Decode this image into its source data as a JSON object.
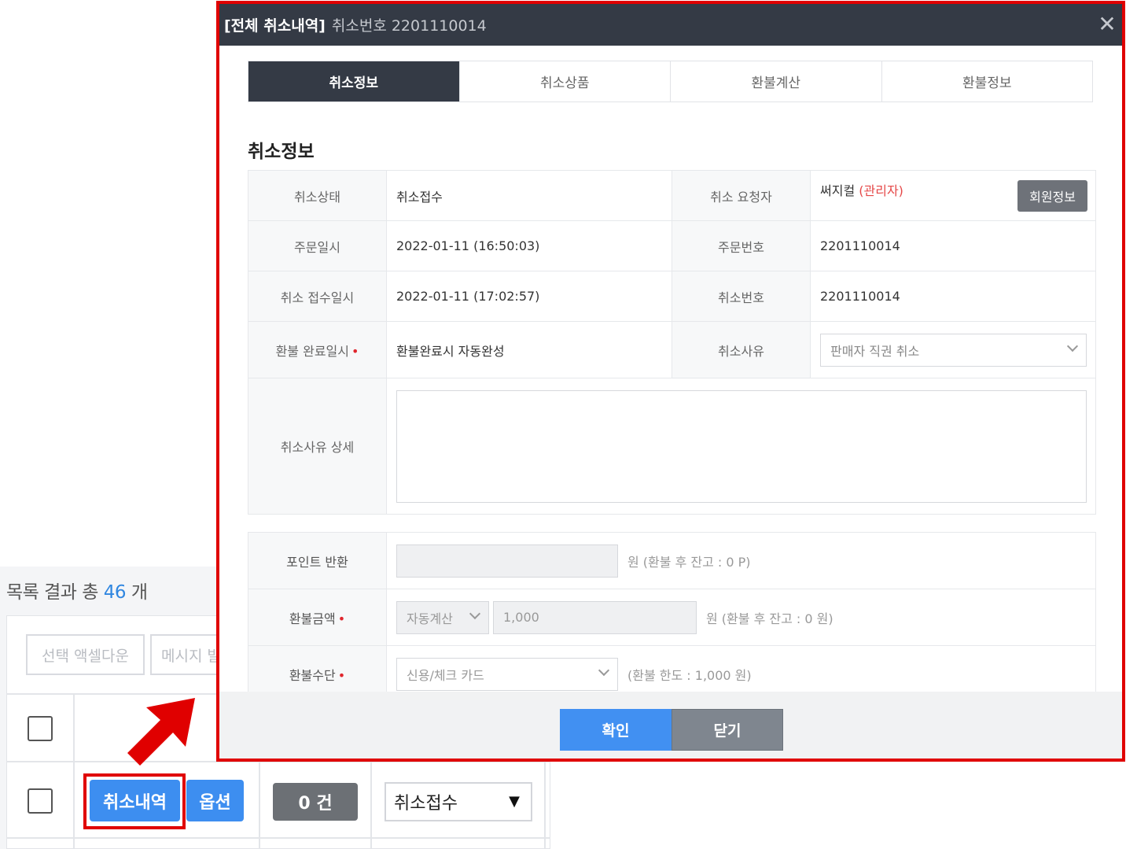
{
  "background": {
    "result_prefix": "목록 결과 총 ",
    "result_count": "46",
    "result_suffix": " 개",
    "toolbar": {
      "excel_button": "선택 액셀다운",
      "message_button": "메시지 발"
    },
    "row": {
      "cancel_history_button": "취소내역",
      "option_button": "옵션",
      "count_badge": "0 건",
      "status_select_value": "취소접수"
    }
  },
  "modal": {
    "title_main": "[전체 취소내역]",
    "title_sub": "취소번호 2201110014",
    "close_icon": "close-icon",
    "tabs": [
      {
        "label": "취소정보",
        "active": true
      },
      {
        "label": "취소상품",
        "active": false
      },
      {
        "label": "환불계산",
        "active": false
      },
      {
        "label": "환불정보",
        "active": false
      }
    ],
    "section_title": "취소정보",
    "info": {
      "cancel_status_label": "취소상태",
      "cancel_status_value": "취소접수",
      "requester_label": "취소 요청자",
      "requester_name": "써지컬",
      "requester_role": "(관리자)",
      "member_info_button": "회원정보",
      "order_date_label": "주문일시",
      "order_date_value": "2022-01-11 (16:50:03)",
      "order_no_label": "주문번호",
      "order_no_value": "2201110014",
      "cancel_received_label": "취소 접수일시",
      "cancel_received_value": "2022-01-11 (17:02:57)",
      "cancel_no_label": "취소번호",
      "cancel_no_value": "2201110014",
      "refund_complete_label": "환불 완료일시",
      "refund_complete_value": "환불완료시 자동완성",
      "cancel_reason_label": "취소사유",
      "cancel_reason_value": "판매자 직권 취소",
      "cancel_reason_detail_label": "취소사유 상세",
      "cancel_reason_detail_value": ""
    },
    "refund": {
      "point_label": "포인트 반환",
      "point_value": "",
      "point_note": "원 (환불 후 잔고 : 0 P)",
      "amount_label": "환불금액",
      "amount_mode": "자동계산",
      "amount_value": "1,000",
      "amount_note": "원 (환불 후 잔고 : 0 원)",
      "method_label": "환불수단",
      "method_value": "신용/체크 카드",
      "method_note": "(환불 한도 : 1,000 원)"
    },
    "footer": {
      "confirm_button": "확인",
      "close_button": "닫기"
    }
  },
  "colors": {
    "highlight_red": "#e00000",
    "header_dark": "#343a45",
    "primary_blue": "#4190f2",
    "required_dot": "#e0262d"
  }
}
